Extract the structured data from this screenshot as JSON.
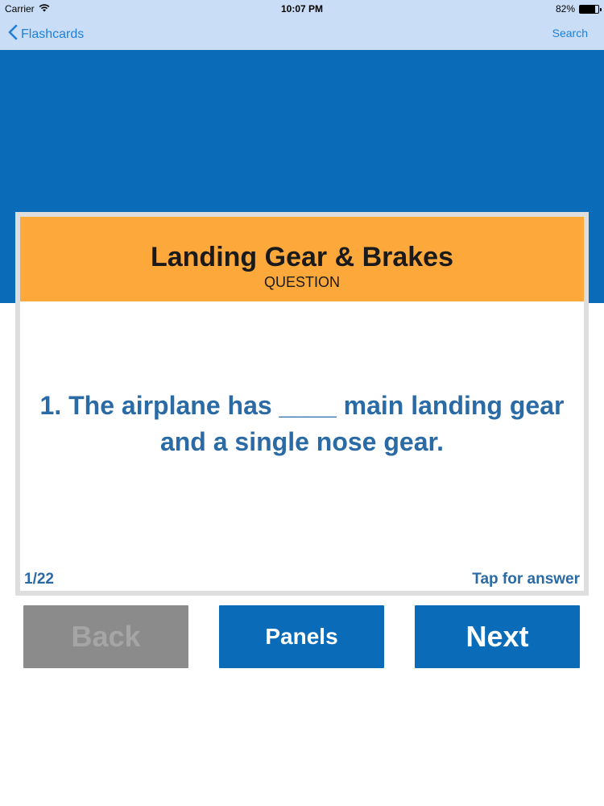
{
  "status_bar": {
    "carrier": "Carrier",
    "time": "10:07 PM",
    "battery_percent": "82%",
    "battery_level": 0.82,
    "wifi_icon": "wifi-icon",
    "battery_icon": "battery-icon"
  },
  "nav": {
    "back_label": "Flashcards",
    "back_icon": "chevron-left-icon",
    "search_label": "Search"
  },
  "card": {
    "title": "Landing Gear & Brakes",
    "subtitle": "QUESTION",
    "question_line1": "1. The airplane has ____ main landing gear",
    "question_line2": "and a single nose gear.",
    "counter": "1/22",
    "tap_hint": "Tap for answer"
  },
  "buttons": {
    "back": "Back",
    "panels": "Panels",
    "next": "Next"
  },
  "colors": {
    "nav_background": "#c9def6",
    "brand_blue": "#0a6cb9",
    "header_orange": "#fca83a",
    "text_blue": "#2a6aa5",
    "disabled_gray": "#8b8b8b"
  }
}
